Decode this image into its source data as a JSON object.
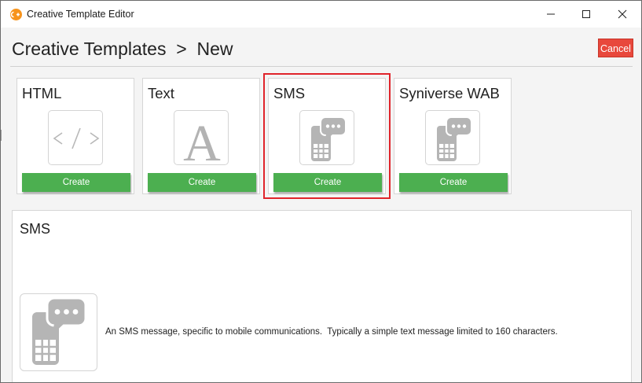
{
  "window": {
    "title": "Creative Template Editor",
    "controls": [
      "minimize-icon",
      "maximize-icon",
      "close-icon"
    ]
  },
  "header": {
    "breadcrumb_root": "Creative Templates",
    "breadcrumb_separator": ">",
    "breadcrumb_current": "New",
    "cancel_label": "Cancel"
  },
  "templates": [
    {
      "title": "HTML",
      "icon": "code-icon",
      "create_label": "Create",
      "selected": false
    },
    {
      "title": "Text",
      "icon": "letter-a-icon",
      "create_label": "Create",
      "selected": false
    },
    {
      "title": "SMS",
      "icon": "sms-phone-icon",
      "create_label": "Create",
      "selected": true
    },
    {
      "title": "Syniverse WAB",
      "icon": "sms-phone-icon",
      "create_label": "Create",
      "selected": false
    }
  ],
  "detail": {
    "title": "SMS",
    "icon": "sms-phone-icon",
    "description": "An SMS message, specific to mobile communications.  Typically a simple text message limited to 160 characters."
  },
  "colors": {
    "create_button": "#4caf50",
    "cancel_button": "#e8483c",
    "selection_outline": "#e0242b",
    "app_icon": "#f7941d"
  }
}
